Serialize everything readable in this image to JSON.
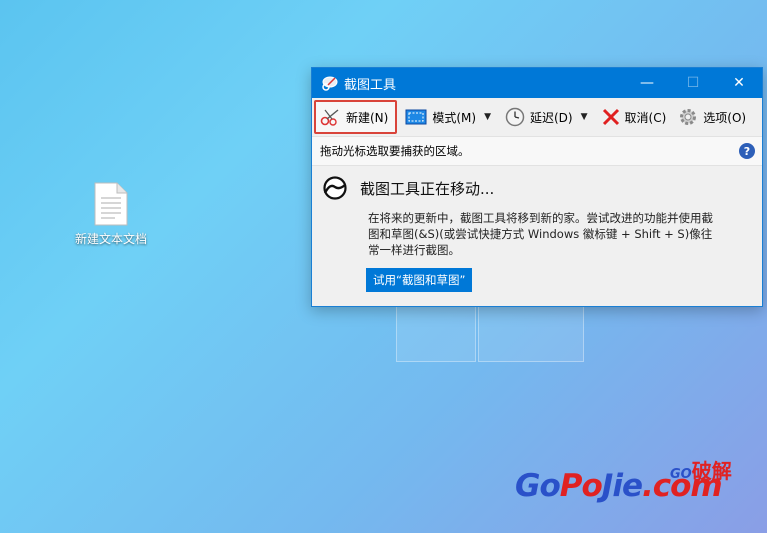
{
  "desktop": {
    "file_icon_label": "新建文本文档"
  },
  "window": {
    "title": "截图工具",
    "titlebar_buttons": {
      "minimize": "—",
      "maximize": "☐",
      "close": "✕"
    },
    "accent_color": "#0078d7"
  },
  "toolbar": {
    "new_label": "新建(N)",
    "mode_label": "模式(M)",
    "delay_label": "延迟(D)",
    "cancel_label": "取消(C)",
    "options_label": "选项(O)",
    "dropdown_glyph": "▼"
  },
  "infobar": {
    "text": "拖动光标选取要捕获的区域。",
    "help_glyph": "?"
  },
  "notice": {
    "title": "截图工具正在移动...",
    "body": "在将来的更新中，截图工具将移到新的家。尝试改进的功能并使用截图和草图(&S)(或尝试快捷方式 Windows 徽标键 + Shift + S)像往常一样进行截图。",
    "try_button": "试用“截图和草图”"
  },
  "watermark": {
    "go": "Go",
    "po": "Po",
    "jie": "Jie",
    "com": ".com",
    "small_go": "GO",
    "small_text": "破解"
  }
}
